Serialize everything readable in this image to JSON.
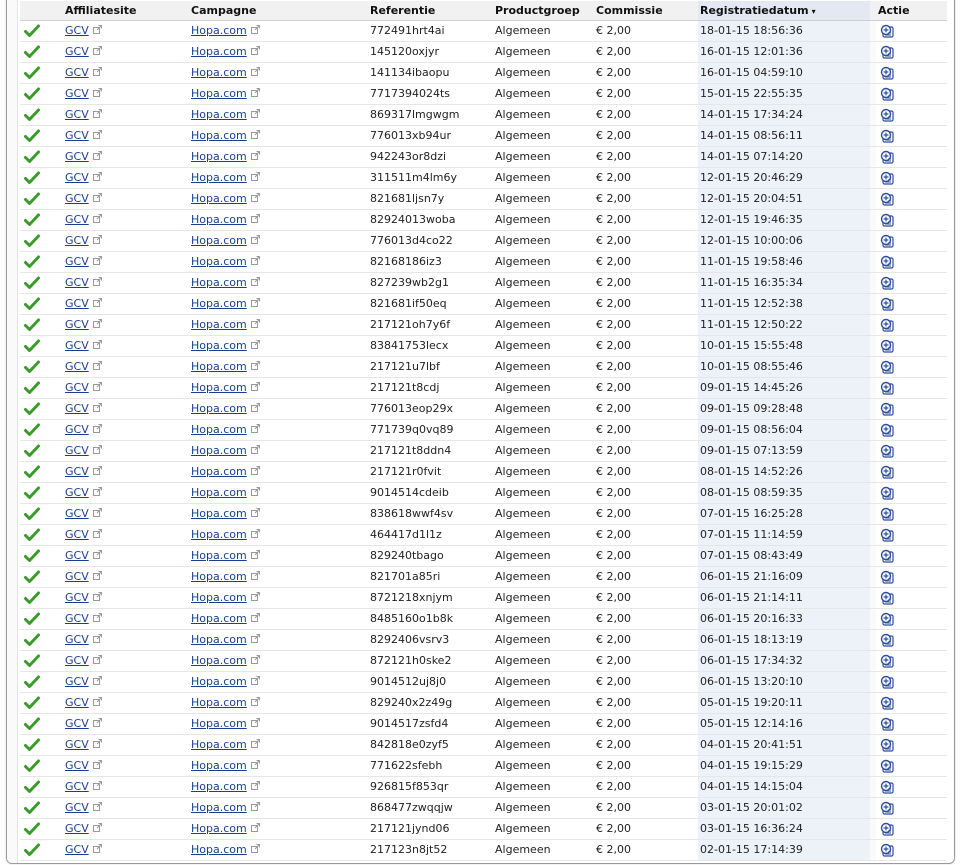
{
  "header": {
    "affiliatesite": "Affiliatesite",
    "campagne": "Campagne",
    "referentie": "Referentie",
    "productgroep": "Productgroep",
    "commissie": "Commissie",
    "registratiedatum": "Registratiedatum",
    "sort_arrow": "▾",
    "actie": "Actie"
  },
  "colors": {
    "check": "#3b9b2a",
    "link": "#1a3f8f",
    "date_column": "#edf1f8",
    "action_icon": "#2c4e9a"
  },
  "icons": {
    "status": "check-icon",
    "external": "external-link-icon",
    "action": "details-icon"
  },
  "rows": [
    {
      "site": "GCV",
      "campaign": "Hopa.com",
      "ref": "772491hrt4ai",
      "group": "Algemeen",
      "commission": "€ 2,00",
      "date": "18-01-15 18:56:36"
    },
    {
      "site": "GCV",
      "campaign": "Hopa.com",
      "ref": "145120oxjyr",
      "group": "Algemeen",
      "commission": "€ 2,00",
      "date": "16-01-15 12:01:36"
    },
    {
      "site": "GCV",
      "campaign": "Hopa.com",
      "ref": "141134ibaopu",
      "group": "Algemeen",
      "commission": "€ 2,00",
      "date": "16-01-15 04:59:10"
    },
    {
      "site": "GCV",
      "campaign": "Hopa.com",
      "ref": "7717394024ts",
      "group": "Algemeen",
      "commission": "€ 2,00",
      "date": "15-01-15 22:55:35"
    },
    {
      "site": "GCV",
      "campaign": "Hopa.com",
      "ref": "869317lmgwgm",
      "group": "Algemeen",
      "commission": "€ 2,00",
      "date": "14-01-15 17:34:24"
    },
    {
      "site": "GCV",
      "campaign": "Hopa.com",
      "ref": "776013xb94ur",
      "group": "Algemeen",
      "commission": "€ 2,00",
      "date": "14-01-15 08:56:11"
    },
    {
      "site": "GCV",
      "campaign": "Hopa.com",
      "ref": "942243or8dzi",
      "group": "Algemeen",
      "commission": "€ 2,00",
      "date": "14-01-15 07:14:20"
    },
    {
      "site": "GCV",
      "campaign": "Hopa.com",
      "ref": "311511m4lm6y",
      "group": "Algemeen",
      "commission": "€ 2,00",
      "date": "12-01-15 20:46:29"
    },
    {
      "site": "GCV",
      "campaign": "Hopa.com",
      "ref": "821681ljsn7y",
      "group": "Algemeen",
      "commission": "€ 2,00",
      "date": "12-01-15 20:04:51"
    },
    {
      "site": "GCV",
      "campaign": "Hopa.com",
      "ref": "82924013woba",
      "group": "Algemeen",
      "commission": "€ 2,00",
      "date": "12-01-15 19:46:35"
    },
    {
      "site": "GCV",
      "campaign": "Hopa.com",
      "ref": "776013d4co22",
      "group": "Algemeen",
      "commission": "€ 2,00",
      "date": "12-01-15 10:00:06"
    },
    {
      "site": "GCV",
      "campaign": "Hopa.com",
      "ref": "82168186iz3",
      "group": "Algemeen",
      "commission": "€ 2,00",
      "date": "11-01-15 19:58:46"
    },
    {
      "site": "GCV",
      "campaign": "Hopa.com",
      "ref": "827239wb2g1",
      "group": "Algemeen",
      "commission": "€ 2,00",
      "date": "11-01-15 16:35:34"
    },
    {
      "site": "GCV",
      "campaign": "Hopa.com",
      "ref": "821681if50eq",
      "group": "Algemeen",
      "commission": "€ 2,00",
      "date": "11-01-15 12:52:38"
    },
    {
      "site": "GCV",
      "campaign": "Hopa.com",
      "ref": "217121oh7y6f",
      "group": "Algemeen",
      "commission": "€ 2,00",
      "date": "11-01-15 12:50:22"
    },
    {
      "site": "GCV",
      "campaign": "Hopa.com",
      "ref": "83841753lecx",
      "group": "Algemeen",
      "commission": "€ 2,00",
      "date": "10-01-15 15:55:48"
    },
    {
      "site": "GCV",
      "campaign": "Hopa.com",
      "ref": "217121u7lbf",
      "group": "Algemeen",
      "commission": "€ 2,00",
      "date": "10-01-15 08:55:46"
    },
    {
      "site": "GCV",
      "campaign": "Hopa.com",
      "ref": "217121t8cdj",
      "group": "Algemeen",
      "commission": "€ 2,00",
      "date": "09-01-15 14:45:26"
    },
    {
      "site": "GCV",
      "campaign": "Hopa.com",
      "ref": "776013eop29x",
      "group": "Algemeen",
      "commission": "€ 2,00",
      "date": "09-01-15 09:28:48"
    },
    {
      "site": "GCV",
      "campaign": "Hopa.com",
      "ref": "771739q0vq89",
      "group": "Algemeen",
      "commission": "€ 2,00",
      "date": "09-01-15 08:56:04"
    },
    {
      "site": "GCV",
      "campaign": "Hopa.com",
      "ref": "217121t8ddn4",
      "group": "Algemeen",
      "commission": "€ 2,00",
      "date": "09-01-15 07:13:59"
    },
    {
      "site": "GCV",
      "campaign": "Hopa.com",
      "ref": "217121r0fvit",
      "group": "Algemeen",
      "commission": "€ 2,00",
      "date": "08-01-15 14:52:26"
    },
    {
      "site": "GCV",
      "campaign": "Hopa.com",
      "ref": "9014514cdeib",
      "group": "Algemeen",
      "commission": "€ 2,00",
      "date": "08-01-15 08:59:35"
    },
    {
      "site": "GCV",
      "campaign": "Hopa.com",
      "ref": "838618wwf4sv",
      "group": "Algemeen",
      "commission": "€ 2,00",
      "date": "07-01-15 16:25:28"
    },
    {
      "site": "GCV",
      "campaign": "Hopa.com",
      "ref": "464417d1l1z",
      "group": "Algemeen",
      "commission": "€ 2,00",
      "date": "07-01-15 11:14:59"
    },
    {
      "site": "GCV",
      "campaign": "Hopa.com",
      "ref": "829240tbago",
      "group": "Algemeen",
      "commission": "€ 2,00",
      "date": "07-01-15 08:43:49"
    },
    {
      "site": "GCV",
      "campaign": "Hopa.com",
      "ref": "821701a85ri",
      "group": "Algemeen",
      "commission": "€ 2,00",
      "date": "06-01-15 21:16:09"
    },
    {
      "site": "GCV",
      "campaign": "Hopa.com",
      "ref": "8721218xnjym",
      "group": "Algemeen",
      "commission": "€ 2,00",
      "date": "06-01-15 21:14:11"
    },
    {
      "site": "GCV",
      "campaign": "Hopa.com",
      "ref": "8485160o1b8k",
      "group": "Algemeen",
      "commission": "€ 2,00",
      "date": "06-01-15 20:16:33"
    },
    {
      "site": "GCV",
      "campaign": "Hopa.com",
      "ref": "8292406vsrv3",
      "group": "Algemeen",
      "commission": "€ 2,00",
      "date": "06-01-15 18:13:19"
    },
    {
      "site": "GCV",
      "campaign": "Hopa.com",
      "ref": "872121h0ske2",
      "group": "Algemeen",
      "commission": "€ 2,00",
      "date": "06-01-15 17:34:32"
    },
    {
      "site": "GCV",
      "campaign": "Hopa.com",
      "ref": "9014512uj8j0",
      "group": "Algemeen",
      "commission": "€ 2,00",
      "date": "06-01-15 13:20:10"
    },
    {
      "site": "GCV",
      "campaign": "Hopa.com",
      "ref": "829240x2z49g",
      "group": "Algemeen",
      "commission": "€ 2,00",
      "date": "05-01-15 19:20:11"
    },
    {
      "site": "GCV",
      "campaign": "Hopa.com",
      "ref": "9014517zsfd4",
      "group": "Algemeen",
      "commission": "€ 2,00",
      "date": "05-01-15 12:14:16"
    },
    {
      "site": "GCV",
      "campaign": "Hopa.com",
      "ref": "842818e0zyf5",
      "group": "Algemeen",
      "commission": "€ 2,00",
      "date": "04-01-15 20:41:51"
    },
    {
      "site": "GCV",
      "campaign": "Hopa.com",
      "ref": "771622sfebh",
      "group": "Algemeen",
      "commission": "€ 2,00",
      "date": "04-01-15 19:15:29"
    },
    {
      "site": "GCV",
      "campaign": "Hopa.com",
      "ref": "926815f853qr",
      "group": "Algemeen",
      "commission": "€ 2,00",
      "date": "04-01-15 14:15:04"
    },
    {
      "site": "GCV",
      "campaign": "Hopa.com",
      "ref": "868477zwqqjw",
      "group": "Algemeen",
      "commission": "€ 2,00",
      "date": "03-01-15 20:01:02"
    },
    {
      "site": "GCV",
      "campaign": "Hopa.com",
      "ref": "217121jynd06",
      "group": "Algemeen",
      "commission": "€ 2,00",
      "date": "03-01-15 16:36:24"
    },
    {
      "site": "GCV",
      "campaign": "Hopa.com",
      "ref": "217123n8jt52",
      "group": "Algemeen",
      "commission": "€ 2,00",
      "date": "02-01-15 17:14:39"
    }
  ]
}
